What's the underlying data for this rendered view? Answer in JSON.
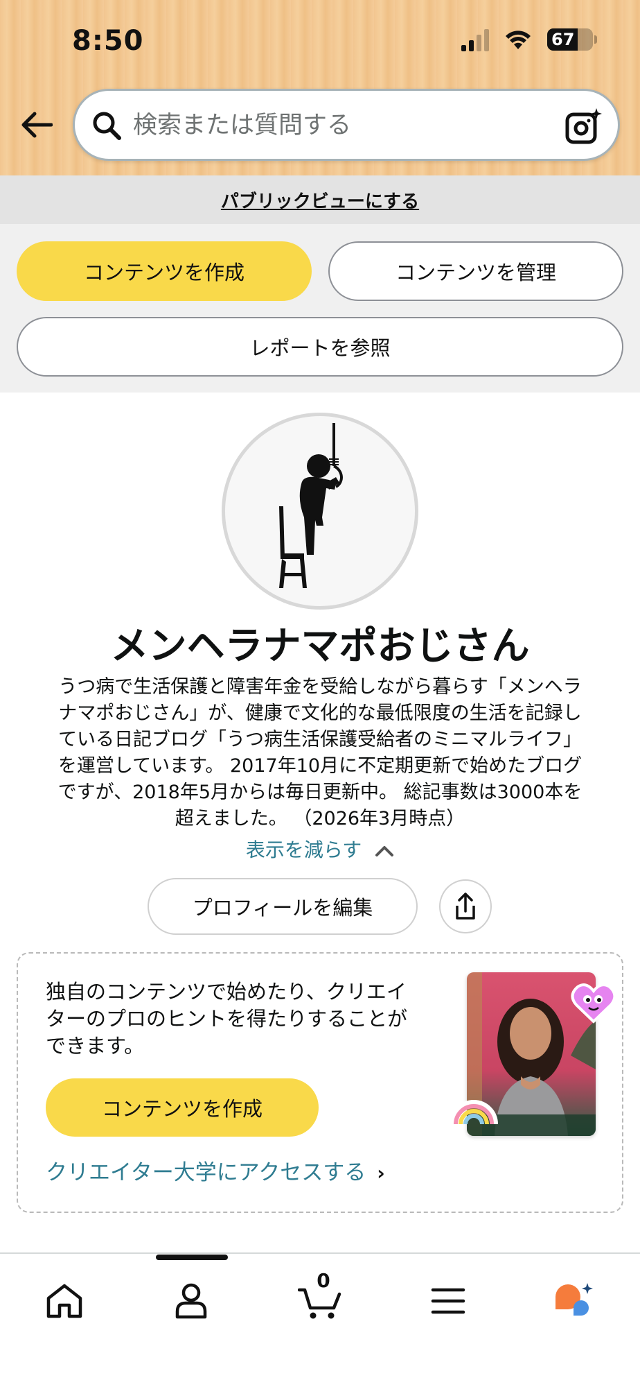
{
  "status_bar": {
    "time": "8:50",
    "battery": "67"
  },
  "search": {
    "placeholder": "検索または質問する"
  },
  "public_view_link": "パブリックビューにする",
  "actions": {
    "create": "コンテンツを作成",
    "manage": "コンテンツを管理",
    "report": "レポートを参照"
  },
  "profile": {
    "name": "メンヘラナマポおじさん",
    "bio_lines": [
      "うつ病で生活保護と障害年金を受給しながら暮らす「メンヘラ",
      "ナマポおじさん」が、健康で文化的な最低限度の生活を記録し",
      "ている日記ブログ「うつ病生活保護受給者のミニマルライフ」",
      "を運営しています。 2017年10月に不定期更新で始めたブログ",
      "ですが、2018年5月からは毎日更新中。 総記事数は3000本を",
      "超えました。 （2026年3月時点）"
    ],
    "show_less": "表示を減らす",
    "edit_profile": "プロフィールを編集"
  },
  "creator_card": {
    "text_lines": [
      "独自のコンテンツで始めたり、クリエイ",
      "ターのプロのヒントを得たりすることが",
      "できます。"
    ],
    "create_button": "コンテンツを作成",
    "university_link": "クリエイター大学にアクセスする"
  },
  "bottom_nav": {
    "items": [
      "home-icon",
      "account-icon",
      "cart-icon",
      "menu-icon",
      "rufus-icon"
    ],
    "cart_count": "0"
  },
  "colors": {
    "header_bg": "#f2c690",
    "accent_yellow": "#f9d94a",
    "link_teal": "#2f7c91"
  }
}
